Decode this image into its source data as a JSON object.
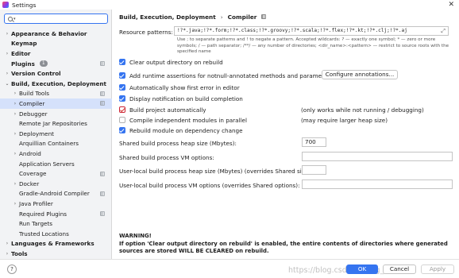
{
  "window": {
    "title": "Settings",
    "close_glyph": "✕"
  },
  "search": {
    "placeholder": "Q+"
  },
  "sidebar": {
    "items": [
      {
        "label": "Appearance & Behavior",
        "arrow": "›"
      },
      {
        "label": "Keymap",
        "arrow": ""
      },
      {
        "label": "Editor",
        "arrow": "›"
      },
      {
        "label": "Plugins",
        "arrow": "",
        "badge": "1"
      },
      {
        "label": "Version Control",
        "arrow": "›"
      },
      {
        "label": "Build, Execution, Deployment",
        "arrow": "⌄"
      },
      {
        "label": "Build Tools",
        "arrow": "›"
      },
      {
        "label": "Compiler",
        "arrow": "›"
      },
      {
        "label": "Debugger",
        "arrow": "›"
      },
      {
        "label": "Remote Jar Repositories",
        "arrow": ""
      },
      {
        "label": "Deployment",
        "arrow": "›"
      },
      {
        "label": "Arquillian Containers",
        "arrow": ""
      },
      {
        "label": "Android",
        "arrow": "›"
      },
      {
        "label": "Application Servers",
        "arrow": ""
      },
      {
        "label": "Coverage",
        "arrow": ""
      },
      {
        "label": "Docker",
        "arrow": "›"
      },
      {
        "label": "Gradle-Android Compiler",
        "arrow": ""
      },
      {
        "label": "Java Profiler",
        "arrow": "›"
      },
      {
        "label": "Required Plugins",
        "arrow": ""
      },
      {
        "label": "Run Targets",
        "arrow": ""
      },
      {
        "label": "Trusted Locations",
        "arrow": ""
      },
      {
        "label": "Languages & Frameworks",
        "arrow": "›"
      },
      {
        "label": "Tools",
        "arrow": "›"
      }
    ]
  },
  "breadcrumb": {
    "parent": "Build, Execution, Deployment",
    "separator": "›",
    "current": "Compiler"
  },
  "resource_patterns": {
    "label": "Resource patterns:",
    "value": "!?*.java;!?*.form;!?*.class;!?*.groovy;!?*.scala;!?*.flex;!?*.kt;!?*.clj;!?*.aj",
    "hint": "Use ; to separate patterns and ! to negate a pattern. Accepted wildcards: ? — exactly one symbol; * — zero or more symbols; / — path separator; /**/ — any number of directories; <dir_name>:<pattern> — restrict to source roots with the specified name"
  },
  "options": [
    {
      "label": "Clear output directory on rebuild",
      "state": "on"
    },
    {
      "label": "Add runtime assertions for notnull-annotated methods and parameters",
      "state": "on"
    },
    {
      "label": "Automatically show first error in editor",
      "state": "on"
    },
    {
      "label": "Display notification on build completion",
      "state": "on"
    },
    {
      "label": "Build project automatically",
      "state": "red",
      "note": "(only works while not running / debugging)"
    },
    {
      "label": "Compile independent modules in parallel",
      "state": "off",
      "note": "(may require larger heap size)"
    },
    {
      "label": "Rebuild module on dependency change",
      "state": "on"
    }
  ],
  "configure_button": "Configure annotations...",
  "heap": {
    "label": "Shared build process heap size (Mbytes):",
    "value": "700"
  },
  "vm_options": {
    "label": "Shared build process VM options:",
    "value": ""
  },
  "local_heap": {
    "label": "User-local build process heap size (Mbytes) (overrides Shared size):",
    "value": ""
  },
  "local_vm": {
    "label": "User-local build process VM options (overrides Shared options):",
    "value": ""
  },
  "warning": {
    "title": "WARNING!",
    "text": "If option 'Clear output directory on rebuild' is enabled, the entire contents of directories where generated sources are stored WILL BE CLEARED on rebuild."
  },
  "footer": {
    "help": "?",
    "ok": "OK",
    "cancel": "Cancel",
    "apply": "Apply"
  },
  "watermark": "https://blog.csdn.net/lijg_niee",
  "colors": {
    "accent": "#3574f0",
    "selection": "#d5e1fb",
    "sidebar_bg": "#f2f3f5"
  }
}
